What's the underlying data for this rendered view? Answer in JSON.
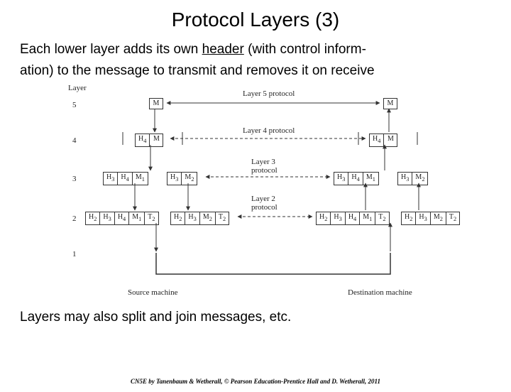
{
  "title": "Protocol Layers (3)",
  "intro_a": "Each lower layer adds its own ",
  "intro_underlined": "header",
  "intro_b": " (with control inform-",
  "intro_c": "ation) to the message to transmit and removes it on receive",
  "caption": "Layers may also split and join messages, etc.",
  "footer": "CN5E by Tanenbaum & Wetherall, © Pearson Education-Prentice Hall and D. Wetherall, 2011",
  "labels": {
    "layer_head": "Layer",
    "l5proto": "Layer 5 protocol",
    "l4proto": "Layer 4 protocol",
    "l3proto": "Layer 3",
    "l3proto2": "protocol",
    "l2proto": "Layer 2",
    "l2proto2": "protocol",
    "source": "Source machine",
    "dest": "Destination machine"
  },
  "layers": {
    "l5": "5",
    "l4": "4",
    "l3": "3",
    "l2": "2",
    "l1": "1"
  },
  "units": {
    "M": "M",
    "H4": "H",
    "s4": "4",
    "H3": "H",
    "s3": "3",
    "H2": "H",
    "s2": "2",
    "M1": "M",
    "sM1": "1",
    "M2": "M",
    "sM2": "2",
    "T2": "T",
    "sT2": "2"
  }
}
